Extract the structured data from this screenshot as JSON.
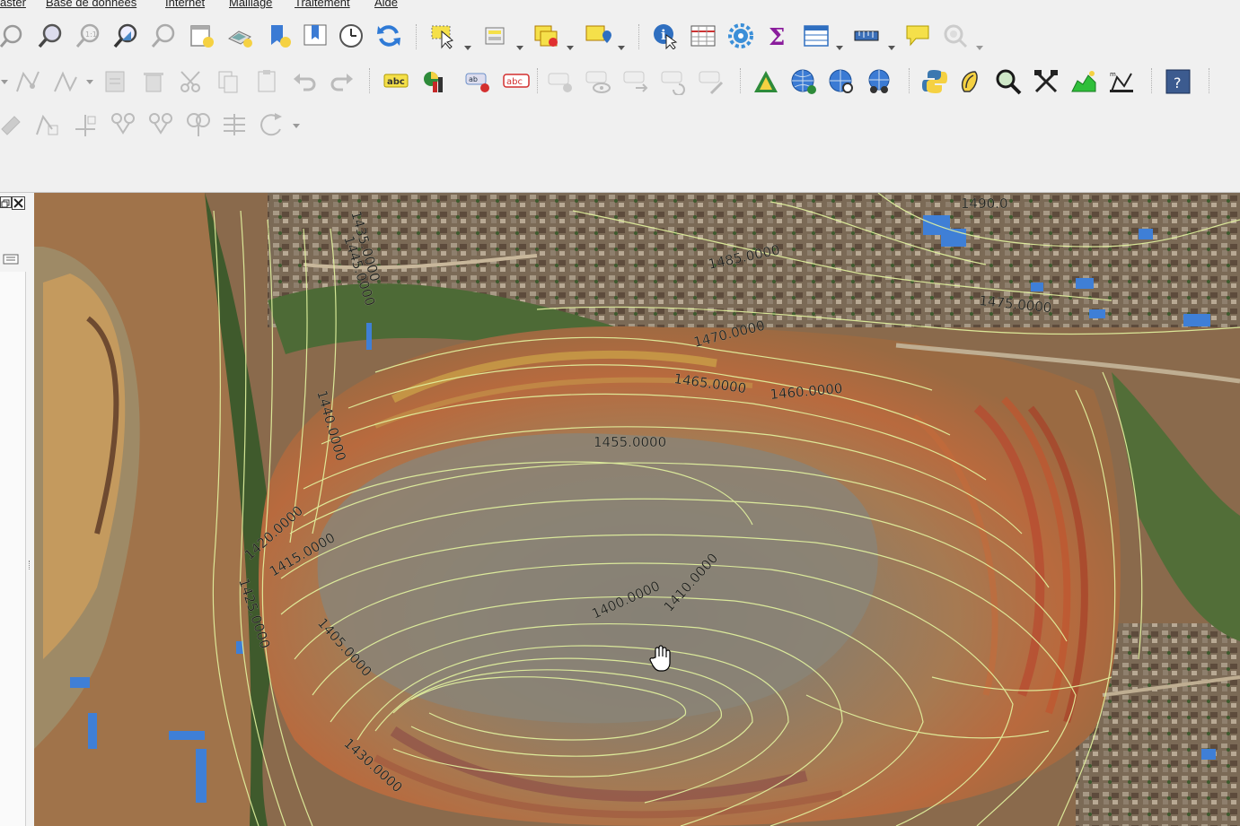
{
  "menu": {
    "items": [
      "aster",
      "Base de données",
      "Internet",
      "Maillage",
      "Traitement",
      "Aide"
    ]
  },
  "toolbar": {
    "row1": [
      "zoom-icon",
      "zoom-in-icon",
      "zoom-native-icon",
      "zoom-to-layer-icon",
      "zoom-last-icon",
      "new-map-view-icon",
      "new-3d-view-icon",
      "new-bookmark-icon",
      "show-bookmarks-icon",
      "temporal-icon",
      "refresh-icon",
      "select-features-icon",
      "select-by-value-icon",
      "deselect-icon",
      "select-location-icon",
      "identify-icon",
      "attribute-table-icon",
      "processing-toolbox-icon",
      "statistics-icon",
      "open-table-icon",
      "measure-icon",
      "map-tips-icon",
      "locator-icon"
    ],
    "row2": [
      "digitize-icon",
      "vertex-tool-icon",
      "node-tool-icon",
      "save-edits-icon",
      "delete-icon",
      "cut-icon",
      "copy-icon",
      "paste-icon",
      "undo-icon",
      "redo-icon",
      "label-icon",
      "diagram-icon",
      "pin-label-icon",
      "highlight-label-icon",
      "label-tool-icon",
      "show-hide-label-icon",
      "move-label-icon",
      "rotate-label-icon",
      "change-label-icon",
      "georeferencer-icon",
      "globe-add-icon",
      "globe-search-icon",
      "globe-network-icon",
      "python-icon",
      "grass-icon",
      "search-icon",
      "tools-icon",
      "profile-icon",
      "mesh-tool-icon",
      "help-icon"
    ],
    "row3": [
      "pencil-icon",
      "add-ring-icon",
      "split-icon",
      "merge-icon",
      "merge-attrs-icon",
      "reshape-icon",
      "offset-icon",
      "rotate-icon"
    ]
  },
  "map": {
    "contour_labels": [
      "1490.0",
      "1485.0000",
      "1475.0000",
      "1470.0000",
      "1465.0000",
      "1460.0000",
      "1455.0000",
      "1445.0000",
      "1440.0000",
      "1420.0000",
      "1415.0000",
      "1425.0000",
      "1405.0000",
      "1400.0000",
      "1410.0000",
      "1430.0000",
      "1435.0000"
    ],
    "colors": {
      "contour": "#e4f5a0",
      "pit_orange": "#c98a50",
      "soil_red": "#b2543a",
      "vegetation": "#3f5a2c",
      "roof_blue": "#3f7fd6"
    }
  },
  "cursor": "hand-cursor-icon"
}
